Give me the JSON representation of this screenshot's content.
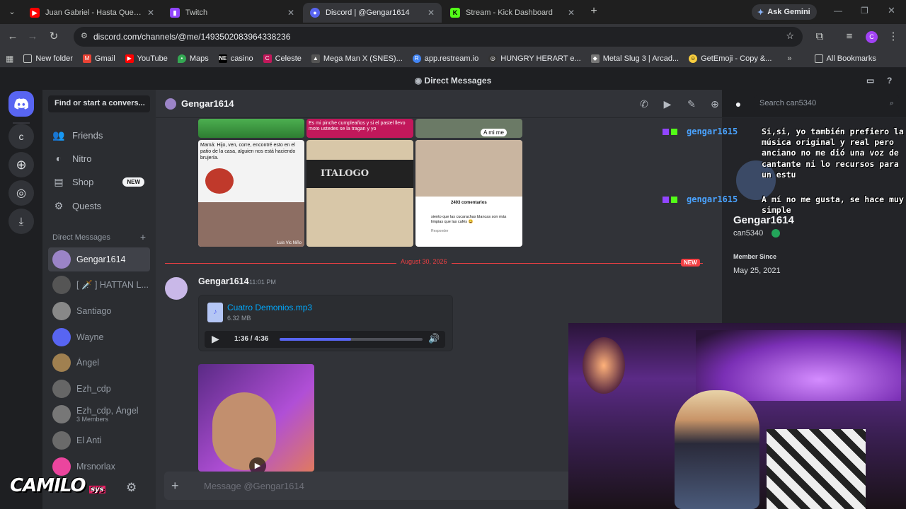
{
  "browser": {
    "tabs": [
      {
        "title": "Juan Gabriel - Hasta Que Te Co",
        "icon": "youtube-icon",
        "color": "#ff0000"
      },
      {
        "title": "Twitch",
        "icon": "twitch-icon",
        "color": "#9146ff"
      },
      {
        "title": "Discord | @Gengar1614",
        "icon": "discord-icon",
        "color": "#5865f2",
        "active": true
      },
      {
        "title": "Stream - Kick Dashboard",
        "icon": "kick-icon",
        "color": "#53fc18"
      }
    ],
    "gemini_label": "Ask Gemini",
    "url": "discord.com/channels/@me/1493502083964338236",
    "profile_letter": "C",
    "bookmarks": [
      {
        "label": "New folder",
        "icon": "folder-icon"
      },
      {
        "label": "Gmail",
        "icon": "gmail-icon"
      },
      {
        "label": "YouTube",
        "icon": "youtube-icon"
      },
      {
        "label": "Maps",
        "icon": "maps-icon"
      },
      {
        "label": "casino",
        "icon": "ne-icon"
      },
      {
        "label": "Celeste",
        "icon": "celeste-icon"
      },
      {
        "label": "Mega Man X (SNES)...",
        "icon": "megaman-icon"
      },
      {
        "label": "app.restream.io",
        "icon": "restream-icon"
      },
      {
        "label": "HUNGRY HERART e...",
        "icon": "hungry-icon"
      },
      {
        "label": "Metal Slug 3 | Arcad...",
        "icon": "metalslug-icon"
      },
      {
        "label": "GetEmoji - Copy &...",
        "icon": "emoji-icon"
      }
    ],
    "all_bookmarks": "All Bookmarks"
  },
  "discord": {
    "window_title": "Direct Messages",
    "server_letter": "c",
    "find_placeholder": "Find or start a convers...",
    "nav": [
      {
        "label": "Friends",
        "icon": "friends-icon"
      },
      {
        "label": "Nitro",
        "icon": "nitro-icon"
      },
      {
        "label": "Shop",
        "icon": "shop-icon",
        "badge": "NEW"
      },
      {
        "label": "Quests",
        "icon": "quests-icon"
      }
    ],
    "dm_header": "Direct Messages",
    "dms": [
      {
        "name": "Gengar1614",
        "selected": true
      },
      {
        "name": "[ 🗡️ ] HATTAN L..."
      },
      {
        "name": "Santiago"
      },
      {
        "name": "Wayne"
      },
      {
        "name": "Ángel"
      },
      {
        "name": "Ezh_cdp"
      },
      {
        "name": "Ezh_cdp, Ángel",
        "sub": "3 Members"
      },
      {
        "name": "El Anti"
      },
      {
        "name": "Mrsnorlax"
      }
    ],
    "chat": {
      "recipient": "Gengar1614",
      "search_placeholder": "Search can5340",
      "meme_captions": {
        "top_middle": "Es mi pinche cumpleaños y si el pastel llevo moto ustedes se la tragan y yo",
        "top_right": "A mi me",
        "mid_left": "Mamá: Hijo, ven, corre, encontré esto en el patio de la casa, alguien nos está haciendo brujería.",
        "mid_middle": "ITALOGO",
        "comments": "2403 comentarios",
        "comment_text": "siento que las cucarachas blancas son más limpias que las cafés 😆",
        "reply": "Responder",
        "watermark": "Luis Vic Niño"
      },
      "date_divider": "August 30, 2026",
      "new_tag": "NEW",
      "message": {
        "author": "Gengar1614",
        "time": "11:01 PM",
        "file_name": "Cuatro Demonios.mp3",
        "file_size": "6.32 MB",
        "playback": "1:36 / 4:36",
        "progress": 0.5
      },
      "input_placeholder": "Message @Gengar1614"
    },
    "profile": {
      "display_name": "Gengar1614",
      "username": "can5340",
      "member_since_label": "Member Since",
      "member_since": "May 25, 2021"
    }
  },
  "stream_overlay": {
    "chat": [
      {
        "user": "gengar1615",
        "text": "Si,si, yo también prefiero la música original y real pero anciano no me dió una voz de cantante ni lo recursos para un estu"
      },
      {
        "user": "gengar1615",
        "text": "A mí no me gusta, se hace muy simple"
      }
    ],
    "logo_text": "CAMILO",
    "logo_sub": "sys"
  },
  "colors": {
    "discord_blurple": "#5865f2",
    "danger_red": "#f23f43",
    "link_blue": "#00a8fc",
    "overlay_user": "#4aa3ff"
  }
}
